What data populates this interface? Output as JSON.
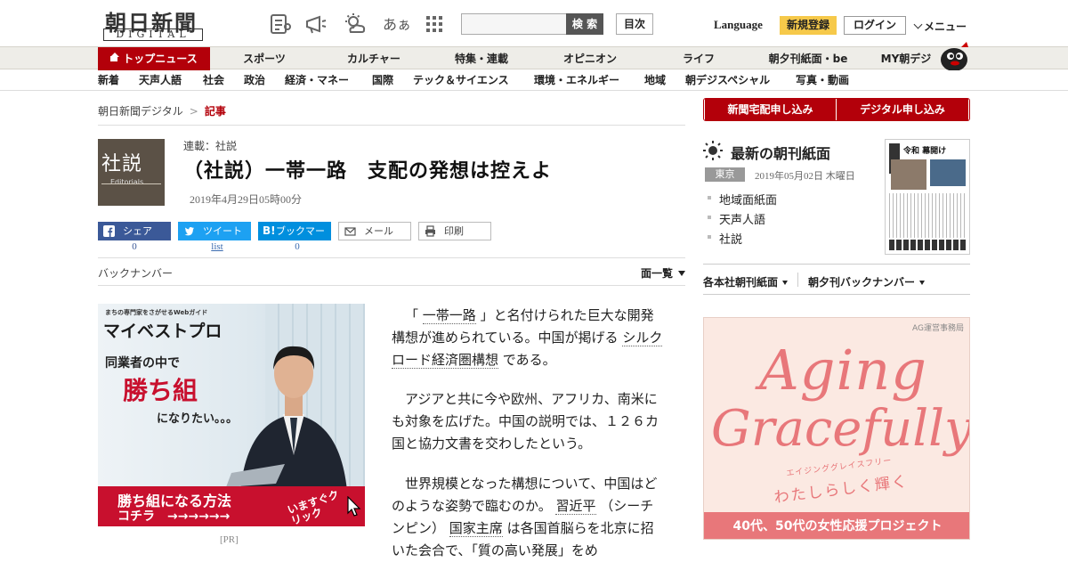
{
  "header": {
    "logo_main": "朝日新聞",
    "logo_sub": "DIGITAL",
    "search_button": "検 索",
    "toc_button": "目次",
    "language": "Language",
    "register": "新規登録",
    "login": "ログイン",
    "menu": "メニュー",
    "icons": [
      "newspaper-icon",
      "megaphone-icon",
      "weather-icon",
      "font-size-icon",
      "grid-icon"
    ],
    "font_icon_text": "あぁ"
  },
  "nav_primary": [
    "トップニュース",
    "スポーツ",
    "カルチャー",
    "特集・連載",
    "オピニオン",
    "ライフ",
    "朝夕刊紙面・be",
    "MY朝デジ"
  ],
  "nav_secondary": [
    "新着",
    "天声人語",
    "社会",
    "政治",
    "経済・マネー",
    "国際",
    "テック＆サイエンス",
    "環境・エネルギー",
    "地域",
    "朝デジスペシャル",
    "写真・動画"
  ],
  "breadcrumb": {
    "home": "朝日新聞デジタル",
    "sep": ">",
    "current": "記事"
  },
  "article": {
    "badge_big": "社説",
    "badge_small": "Editorials",
    "series": "連載：社説",
    "title": "（社説）一帯一路　支配の発想は控えよ",
    "date": "2019年4月29日05時00分",
    "share": {
      "facebook": "シェア",
      "facebook_count": "0",
      "twitter": "ツイート",
      "twitter_count": "list",
      "hatena": "ブックマーク",
      "hatena_count": "0",
      "mail": "メール",
      "print": "印刷"
    },
    "backnumber": "バックナンバー",
    "page_list": "面一覧",
    "paragraphs": [
      {
        "pre": "「",
        "link1": "一帯一路",
        "mid": "」と名付けられた巨大な開発構想が進められている。中国が掲げる",
        "link2": "シルクロード経済圏構想",
        "post": "である。"
      },
      {
        "text": "アジアと共に今や欧州、アフリカ、南米にも対象を広げた。中国の説明では、１２６カ国と協力文書を交わしたという。"
      },
      {
        "pre": "世界規模となった構想について、中国はどのような姿勢で臨むのか。",
        "link1": "習近平",
        "mid": "（シーチンピン）",
        "link2": "国家主席",
        "post": "は各国首脳らを北京に招いた会合で、「質の高い発展」をめ"
      }
    ]
  },
  "ad_left": {
    "tagline": "まちの専門家をさがせるWebガイド",
    "brand": "マイベストプロ",
    "line1": "同業者の中で",
    "line2": "勝ち組",
    "line3": "になりたい。。。",
    "banner1": "勝ち組になる方法",
    "banner2": "コチラ　→→→→→→",
    "click": "いますぐクリック",
    "pr": "[PR]"
  },
  "sidebar": {
    "sub_home": "新聞宅配申し込み",
    "sub_digital": "デジタル申し込み",
    "chokan_title": "最新の朝刊紙面",
    "region": "東京",
    "chokan_date": "2019年05月02日 木曜日",
    "links": [
      "地域面紙面",
      "天声人語",
      "社説"
    ],
    "paper_headline": "令和 幕開け",
    "nav_left": "各本社朝刊紙面",
    "nav_right": "朝夕刊バックナンバー"
  },
  "ad_right": {
    "agency": "AG運営事務局",
    "line1": "Aging",
    "line2": "Gracefully",
    "ruby": "エイジンググレイスフリー",
    "jp": "わたしらしく輝く",
    "banner": "40代、50代の女性応援プロジェクト"
  },
  "colors": {
    "brand_red": "#b3000a",
    "register_yellow": "#f6c94a",
    "facebook": "#3b5998",
    "twitter": "#1da1f2",
    "hatena": "#008fde",
    "ad_pink": "#e8777a"
  }
}
